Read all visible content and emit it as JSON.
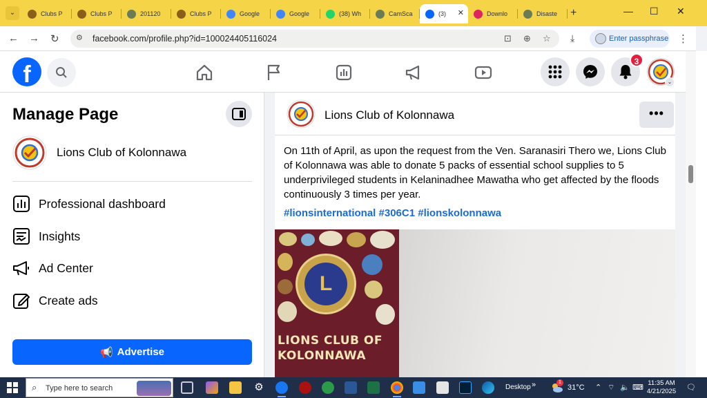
{
  "browser": {
    "tabs": [
      {
        "label": "Clubs P",
        "icon": "lions-club-favicon",
        "color": "#8b5e1a",
        "active": false
      },
      {
        "label": "Clubs P",
        "icon": "lions-club-favicon",
        "color": "#8b5e1a",
        "active": false
      },
      {
        "label": "201120",
        "icon": "globe-favicon",
        "color": "#6b7c55",
        "active": false
      },
      {
        "label": "Clubs P",
        "icon": "lions-club-favicon",
        "color": "#8b5e1a",
        "active": false
      },
      {
        "label": "Google",
        "icon": "google-translate-favicon",
        "color": "#4285f4",
        "active": false
      },
      {
        "label": "Google",
        "icon": "google-translate-favicon",
        "color": "#4285f4",
        "active": false
      },
      {
        "label": "(38) Wh",
        "icon": "whatsapp-favicon",
        "color": "#25d366",
        "active": false
      },
      {
        "label": "CamSca",
        "icon": "globe-favicon",
        "color": "#6b7c55",
        "active": false
      },
      {
        "label": "(3)",
        "icon": "facebook-favicon",
        "color": "#0866ff",
        "active": true
      },
      {
        "label": "Downlo",
        "icon": "heart-favicon",
        "color": "#e0245e",
        "active": false
      },
      {
        "label": "Disaste",
        "icon": "globe-favicon",
        "color": "#6b7c55",
        "active": false
      }
    ],
    "url": "facebook.com/profile.php?id=100024405116024",
    "passphrase_label": "Enter passphrase"
  },
  "fb": {
    "notification_count": "3",
    "colors": {
      "brand": "#0866ff",
      "badge": "#e41e3f"
    }
  },
  "sidebar": {
    "title": "Manage Page",
    "page_name": "Lions Club of Kolonnawa",
    "items": [
      {
        "label": "Professional dashboard",
        "icon": "dashboard-icon"
      },
      {
        "label": "Insights",
        "icon": "insights-icon"
      },
      {
        "label": "Ad Center",
        "icon": "megaphone-icon"
      },
      {
        "label": "Create ads",
        "icon": "pencil-icon"
      }
    ],
    "advertise_label": "Advertise"
  },
  "post": {
    "author": "Lions Club of Kolonnawa",
    "more_label": "•••",
    "text": "On 11th of April, as upon the request from the Ven. Saranasiri Thero we, Lions Club of Kolonnawa was able to donate 5 packs of essential school supplies to 5 underprivileged students in Kelaninadhee Mawatha who get  affected by the floods continuously 3 times per year.",
    "hashtags": "#lionsinternational #306C1 #lionskolonnawa",
    "photo_text_line1": "LIONS CLUB OF",
    "photo_text_line2": "KOLONNAWA",
    "photo_emblem_letter": "L"
  },
  "taskbar": {
    "search_placeholder": "Type here to search",
    "desktop_label": "Desktop",
    "temperature": "31°C",
    "weather_badge": "1",
    "time": "11:35 AM",
    "date": "4/21/2025"
  }
}
